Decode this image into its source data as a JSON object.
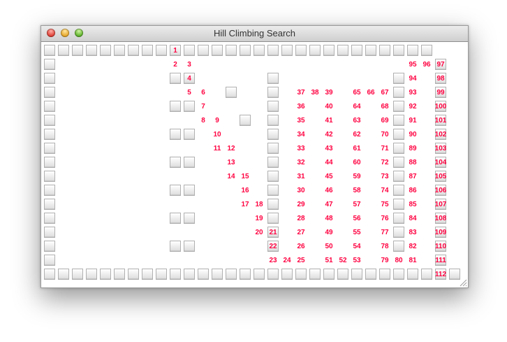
{
  "window": {
    "title": "Hill Climbing Search"
  },
  "colors": {
    "path_text": "#ff0040",
    "title_text": "#333333"
  },
  "grid": {
    "cols": 30,
    "rows": 17,
    "rows_data": [
      "############################~~",
      "#...........................#~",
      "#........##.....#........#..#~",
      "#............#..#........#..#~",
      "#........##.....#........#..#~",
      "#.............#.#........#..#~",
      "#........##.....#........#..#~",
      "#...............#........#..#~",
      "#........##.....#........#..#~",
      "#...............#........#..#~",
      "#........##.....#........#..#~",
      "#...............#........#..#~",
      "#........##.....#........#..#~",
      "#...............#........#..#~",
      "#........##.....#........#..#~",
      "#...........................#~",
      "##############################"
    ],
    "path": [
      {
        "n": "1",
        "r": 0,
        "c": 9
      },
      {
        "n": "2",
        "r": 1,
        "c": 9
      },
      {
        "n": "3",
        "r": 1,
        "c": 10
      },
      {
        "n": "4",
        "r": 2,
        "c": 10
      },
      {
        "n": "5",
        "r": 3,
        "c": 10
      },
      {
        "n": "6",
        "r": 3,
        "c": 11
      },
      {
        "n": "7",
        "r": 4,
        "c": 11
      },
      {
        "n": "8",
        "r": 5,
        "c": 11
      },
      {
        "n": "9",
        "r": 5,
        "c": 12
      },
      {
        "n": "10",
        "r": 6,
        "c": 12
      },
      {
        "n": "11",
        "r": 7,
        "c": 12
      },
      {
        "n": "12",
        "r": 7,
        "c": 13
      },
      {
        "n": "13",
        "r": 8,
        "c": 13
      },
      {
        "n": "14",
        "r": 9,
        "c": 13
      },
      {
        "n": "15",
        "r": 9,
        "c": 14
      },
      {
        "n": "16",
        "r": 10,
        "c": 14
      },
      {
        "n": "17",
        "r": 11,
        "c": 14
      },
      {
        "n": "18",
        "r": 11,
        "c": 15
      },
      {
        "n": "19",
        "r": 12,
        "c": 15
      },
      {
        "n": "20",
        "r": 13,
        "c": 15
      },
      {
        "n": "21",
        "r": 13,
        "c": 16
      },
      {
        "n": "22",
        "r": 14,
        "c": 16
      },
      {
        "n": "23",
        "r": 15,
        "c": 16
      },
      {
        "n": "24",
        "r": 15,
        "c": 17
      },
      {
        "n": "25",
        "r": 15,
        "c": 18
      },
      {
        "n": "26",
        "r": 14,
        "c": 18
      },
      {
        "n": "27",
        "r": 13,
        "c": 18
      },
      {
        "n": "28",
        "r": 12,
        "c": 18
      },
      {
        "n": "29",
        "r": 11,
        "c": 18
      },
      {
        "n": "30",
        "r": 10,
        "c": 18
      },
      {
        "n": "31",
        "r": 9,
        "c": 18
      },
      {
        "n": "32",
        "r": 8,
        "c": 18
      },
      {
        "n": "33",
        "r": 7,
        "c": 18
      },
      {
        "n": "34",
        "r": 6,
        "c": 18
      },
      {
        "n": "35",
        "r": 5,
        "c": 18
      },
      {
        "n": "36",
        "r": 4,
        "c": 18
      },
      {
        "n": "37",
        "r": 3,
        "c": 18
      },
      {
        "n": "38",
        "r": 3,
        "c": 19
      },
      {
        "n": "39",
        "r": 3,
        "c": 20
      },
      {
        "n": "40",
        "r": 4,
        "c": 20
      },
      {
        "n": "41",
        "r": 5,
        "c": 20
      },
      {
        "n": "42",
        "r": 6,
        "c": 20
      },
      {
        "n": "43",
        "r": 7,
        "c": 20
      },
      {
        "n": "44",
        "r": 8,
        "c": 20
      },
      {
        "n": "45",
        "r": 9,
        "c": 20
      },
      {
        "n": "46",
        "r": 10,
        "c": 20
      },
      {
        "n": "47",
        "r": 11,
        "c": 20
      },
      {
        "n": "48",
        "r": 12,
        "c": 20
      },
      {
        "n": "49",
        "r": 13,
        "c": 20
      },
      {
        "n": "50",
        "r": 14,
        "c": 20
      },
      {
        "n": "51",
        "r": 15,
        "c": 20
      },
      {
        "n": "52",
        "r": 15,
        "c": 21
      },
      {
        "n": "53",
        "r": 15,
        "c": 22
      },
      {
        "n": "54",
        "r": 14,
        "c": 22
      },
      {
        "n": "55",
        "r": 13,
        "c": 22
      },
      {
        "n": "56",
        "r": 12,
        "c": 22
      },
      {
        "n": "57",
        "r": 11,
        "c": 22
      },
      {
        "n": "58",
        "r": 10,
        "c": 22
      },
      {
        "n": "59",
        "r": 9,
        "c": 22
      },
      {
        "n": "60",
        "r": 8,
        "c": 22
      },
      {
        "n": "61",
        "r": 7,
        "c": 22
      },
      {
        "n": "62",
        "r": 6,
        "c": 22
      },
      {
        "n": "63",
        "r": 5,
        "c": 22
      },
      {
        "n": "64",
        "r": 4,
        "c": 22
      },
      {
        "n": "65",
        "r": 3,
        "c": 22
      },
      {
        "n": "66",
        "r": 3,
        "c": 23
      },
      {
        "n": "67",
        "r": 3,
        "c": 24
      },
      {
        "n": "68",
        "r": 4,
        "c": 24
      },
      {
        "n": "69",
        "r": 5,
        "c": 24
      },
      {
        "n": "70",
        "r": 6,
        "c": 24
      },
      {
        "n": "71",
        "r": 7,
        "c": 24
      },
      {
        "n": "72",
        "r": 8,
        "c": 24
      },
      {
        "n": "73",
        "r": 9,
        "c": 24
      },
      {
        "n": "74",
        "r": 10,
        "c": 24
      },
      {
        "n": "75",
        "r": 11,
        "c": 24
      },
      {
        "n": "76",
        "r": 12,
        "c": 24
      },
      {
        "n": "77",
        "r": 13,
        "c": 24
      },
      {
        "n": "78",
        "r": 14,
        "c": 24
      },
      {
        "n": "79",
        "r": 15,
        "c": 24
      },
      {
        "n": "80",
        "r": 15,
        "c": 25
      },
      {
        "n": "81",
        "r": 15,
        "c": 26
      },
      {
        "n": "82",
        "r": 14,
        "c": 26
      },
      {
        "n": "83",
        "r": 13,
        "c": 26
      },
      {
        "n": "84",
        "r": 12,
        "c": 26
      },
      {
        "n": "85",
        "r": 11,
        "c": 26
      },
      {
        "n": "86",
        "r": 10,
        "c": 26
      },
      {
        "n": "87",
        "r": 9,
        "c": 26
      },
      {
        "n": "88",
        "r": 8,
        "c": 26
      },
      {
        "n": "89",
        "r": 7,
        "c": 26
      },
      {
        "n": "90",
        "r": 6,
        "c": 26
      },
      {
        "n": "91",
        "r": 5,
        "c": 26
      },
      {
        "n": "92",
        "r": 4,
        "c": 26
      },
      {
        "n": "93",
        "r": 3,
        "c": 26
      },
      {
        "n": "94",
        "r": 2,
        "c": 26
      },
      {
        "n": "95",
        "r": 1,
        "c": 26
      },
      {
        "n": "96",
        "r": 1,
        "c": 27
      },
      {
        "n": "97",
        "r": 1,
        "c": 28
      },
      {
        "n": "98",
        "r": 2,
        "c": 28
      },
      {
        "n": "99",
        "r": 3,
        "c": 28
      },
      {
        "n": "100",
        "r": 4,
        "c": 28
      },
      {
        "n": "101",
        "r": 5,
        "c": 28
      },
      {
        "n": "102",
        "r": 6,
        "c": 28
      },
      {
        "n": "103",
        "r": 7,
        "c": 28
      },
      {
        "n": "104",
        "r": 8,
        "c": 28
      },
      {
        "n": "105",
        "r": 9,
        "c": 28
      },
      {
        "n": "106",
        "r": 10,
        "c": 28
      },
      {
        "n": "107",
        "r": 11,
        "c": 28
      },
      {
        "n": "108",
        "r": 12,
        "c": 28
      },
      {
        "n": "109",
        "r": 13,
        "c": 28
      },
      {
        "n": "110",
        "r": 14,
        "c": 28
      },
      {
        "n": "111",
        "r": 15,
        "c": 28
      },
      {
        "n": "112",
        "r": 16,
        "c": 28
      }
    ]
  }
}
